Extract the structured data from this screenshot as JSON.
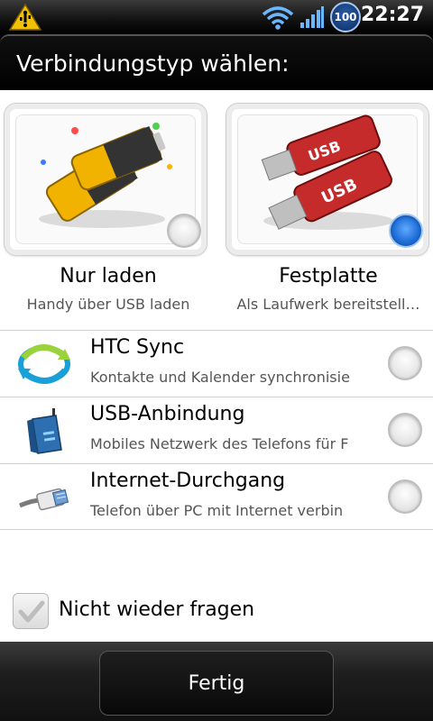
{
  "status": {
    "battery": "100",
    "time": "22:27"
  },
  "dialog": {
    "title": "Verbindungstyp wählen:"
  },
  "modes": [
    {
      "label": "Nur laden",
      "desc": "Handy über USB laden",
      "selected": false
    },
    {
      "label": "Festplatte",
      "desc": "Als Laufwerk bereitstell…",
      "selected": true
    }
  ],
  "options": [
    {
      "label": "HTC Sync",
      "desc": "Kontakte und Kalender synchronisie",
      "icon": "sync-icon"
    },
    {
      "label": "USB-Anbindung",
      "desc": "Mobiles Netzwerk des Telefons für F",
      "icon": "modem-icon"
    },
    {
      "label": "Internet-Durchgang",
      "desc": "Telefon über PC mit Internet verbin",
      "icon": "network-cable-icon"
    }
  ],
  "checkbox": {
    "label": "Nicht wieder fragen",
    "checked": true
  },
  "button": {
    "label": "Fertig"
  },
  "colors": {
    "accent": "#1f6fd8",
    "dialog_bg": "#ffffff",
    "bar_bg": "#1e1e1e"
  }
}
